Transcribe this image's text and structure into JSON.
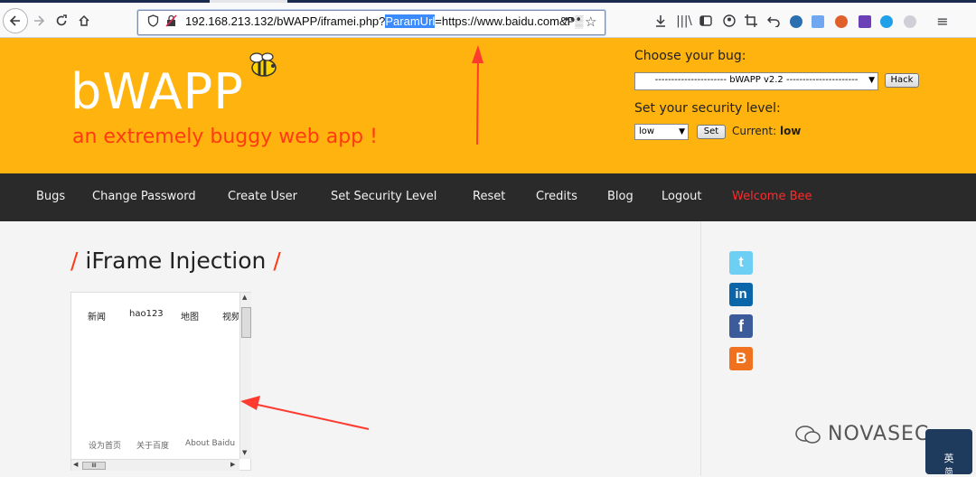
{
  "browser": {
    "url_prefix": "192.168.213.132/bWAPP/iframei.php?",
    "url_selected": "ParamUrl",
    "url_suffix": "=https://www.baidu.com&P",
    "more_label": "•••"
  },
  "header": {
    "logo": "bWAPP",
    "tagline": "an extremely buggy web app !",
    "choose_bug_label": "Choose your bug:",
    "bug_selected": "---------------------- bWAPP v2.2 ----------------------",
    "hack_button": "Hack",
    "security_label": "Set your security level:",
    "security_selected": "low",
    "set_button": "Set",
    "current_label": "Current:",
    "current_value": "low"
  },
  "nav": {
    "items": [
      "Bugs",
      "Change Password",
      "Create User",
      "Set Security Level",
      "Reset",
      "Credits",
      "Blog",
      "Logout"
    ],
    "welcome": "Welcome Bee"
  },
  "content": {
    "title": "iFrame Injection",
    "slash": "/"
  },
  "iframe": {
    "links": [
      "新闻",
      "hao123",
      "地图",
      "视频"
    ],
    "footer": [
      "设为首页",
      "关于百度",
      "About Baidu"
    ],
    "hthumb": "III"
  },
  "social": [
    "twitter-icon",
    "linkedin-icon",
    "facebook-icon",
    "blogger-icon"
  ],
  "watermark": "NOVASEC",
  "ime": {
    "top": "英",
    "bottom": "简"
  },
  "colors": {
    "header": "#ffb30f",
    "accent": "#ff3a12",
    "nav": "#2a2a2a",
    "selection": "#3b8aff"
  }
}
